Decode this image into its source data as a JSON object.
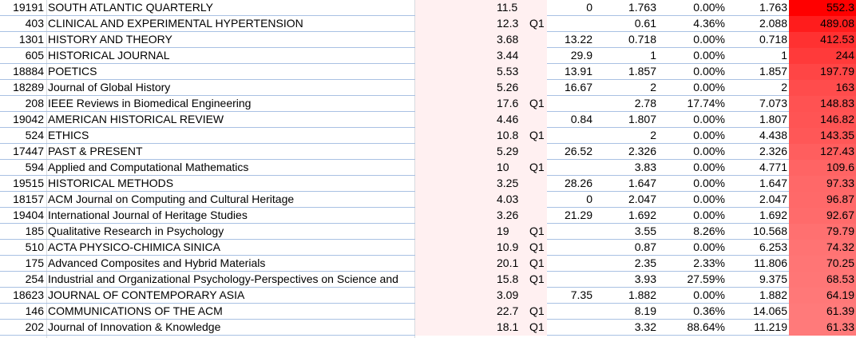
{
  "rows": [
    {
      "id": "19191",
      "name": "SOUTH ATLANTIC QUARTERLY",
      "if": "11.5",
      "q": "",
      "v2": "0",
      "v3": "1.763",
      "v4": "0.00%",
      "v5": "1.763",
      "v6": "552.3",
      "heat": "#ff0000"
    },
    {
      "id": "403",
      "name": "CLINICAL AND EXPERIMENTAL HYPERTENSION",
      "if": "12.3",
      "q": "Q1",
      "v2": "",
      "v3": "0.61",
      "v4": "4.36%",
      "v5": "2.088",
      "v6": "489.08",
      "heat": "#ff1c1c"
    },
    {
      "id": "1301",
      "name": "HISTORY AND THEORY",
      "if": "3.68",
      "q": "",
      "v2": "13.22",
      "v3": "0.718",
      "v4": "0.00%",
      "v5": "0.718",
      "v6": "412.53",
      "heat": "#ff3131"
    },
    {
      "id": "605",
      "name": "HISTORICAL JOURNAL",
      "if": "3.44",
      "q": "",
      "v2": "29.9",
      "v3": "1",
      "v4": "0.00%",
      "v5": "1",
      "v6": "244",
      "heat": "#ff3a3a"
    },
    {
      "id": "18884",
      "name": "POETICS",
      "if": "5.53",
      "q": "",
      "v2": "13.91",
      "v3": "1.857",
      "v4": "0.00%",
      "v5": "1.857",
      "v6": "197.79",
      "heat": "#ff4545"
    },
    {
      "id": "18289",
      "name": "Journal of Global History",
      "if": "5.26",
      "q": "",
      "v2": "16.67",
      "v3": "2",
      "v4": "0.00%",
      "v5": "2",
      "v6": "163",
      "heat": "#ff4c4c"
    },
    {
      "id": "208",
      "name": "IEEE Reviews in Biomedical Engineering",
      "if": "17.6",
      "q": "Q1",
      "v2": "",
      "v3": "2.78",
      "v4": "17.74%",
      "v5": "7.073",
      "v6": "148.83",
      "heat": "#ff5252"
    },
    {
      "id": "19042",
      "name": "AMERICAN HISTORICAL REVIEW",
      "if": "4.46",
      "q": "",
      "v2": "0.84",
      "v3": "1.807",
      "v4": "0.00%",
      "v5": "1.807",
      "v6": "146.82",
      "heat": "#ff5454"
    },
    {
      "id": "524",
      "name": "ETHICS",
      "if": "10.8",
      "q": "Q1",
      "v2": "",
      "v3": "2",
      "v4": "0.00%",
      "v5": "4.438",
      "v6": "143.35",
      "heat": "#ff5757"
    },
    {
      "id": "17447",
      "name": "PAST & PRESENT",
      "if": "5.29",
      "q": "",
      "v2": "26.52",
      "v3": "2.326",
      "v4": "0.00%",
      "v5": "2.326",
      "v6": "127.43",
      "heat": "#ff5e5e"
    },
    {
      "id": "594",
      "name": "Applied and Computational Mathematics",
      "if": "10",
      "q": "Q1",
      "v2": "",
      "v3": "3.83",
      "v4": "0.00%",
      "v5": "4.771",
      "v6": "109.6",
      "heat": "#ff6464"
    },
    {
      "id": "19515",
      "name": "HISTORICAL METHODS",
      "if": "3.25",
      "q": "",
      "v2": "28.26",
      "v3": "1.647",
      "v4": "0.00%",
      "v5": "1.647",
      "v6": "97.33",
      "heat": "#ff6868"
    },
    {
      "id": "18157",
      "name": "ACM Journal on Computing and Cultural Heritage",
      "if": "4.03",
      "q": "",
      "v2": "0",
      "v3": "2.047",
      "v4": "0.00%",
      "v5": "2.047",
      "v6": "96.87",
      "heat": "#ff6969"
    },
    {
      "id": "19404",
      "name": "International Journal of Heritage Studies",
      "if": "3.26",
      "q": "",
      "v2": "21.29",
      "v3": "1.692",
      "v4": "0.00%",
      "v5": "1.692",
      "v6": "92.67",
      "heat": "#ff6b6b"
    },
    {
      "id": "185",
      "name": "Qualitative Research in Psychology",
      "if": "19",
      "q": "Q1",
      "v2": "",
      "v3": "3.55",
      "v4": "8.26%",
      "v5": "10.568",
      "v6": "79.79",
      "heat": "#ff7070"
    },
    {
      "id": "510",
      "name": "ACTA PHYSICO-CHIMICA SINICA",
      "if": "10.9",
      "q": "Q1",
      "v2": "",
      "v3": "0.87",
      "v4": "0.00%",
      "v5": "6.253",
      "v6": "74.32",
      "heat": "#ff7373"
    },
    {
      "id": "175",
      "name": "Advanced Composites and Hybrid Materials",
      "if": "20.1",
      "q": "Q1",
      "v2": "",
      "v3": "2.35",
      "v4": "2.33%",
      "v5": "11.806",
      "v6": "70.25",
      "heat": "#ff7575"
    },
    {
      "id": "254",
      "name": "Industrial and Organizational Psychology-Perspectives on Science and",
      "if": "15.8",
      "q": "Q1",
      "v2": "",
      "v3": "3.93",
      "v4": "27.59%",
      "v5": "9.375",
      "v6": "68.53",
      "heat": "#ff7676"
    },
    {
      "id": "18623",
      "name": "JOURNAL OF CONTEMPORARY ASIA",
      "if": "3.09",
      "q": "",
      "v2": "7.35",
      "v3": "1.882",
      "v4": "0.00%",
      "v5": "1.882",
      "v6": "64.19",
      "heat": "#ff7878"
    },
    {
      "id": "146",
      "name": "COMMUNICATIONS OF THE ACM",
      "if": "22.7",
      "q": "Q1",
      "v2": "",
      "v3": "8.19",
      "v4": "0.36%",
      "v5": "14.065",
      "v6": "61.39",
      "heat": "#ff7a7a"
    },
    {
      "id": "202",
      "name": "Journal of Innovation & Knowledge",
      "if": "18.1",
      "q": "Q1",
      "v2": "",
      "v3": "3.32",
      "v4": "88.64%",
      "v5": "11.219",
      "v6": "61.33",
      "heat": "#ff7a7a"
    }
  ],
  "colors": {
    "grid": "#a9c1e3",
    "if_fill": "#fff0f1"
  }
}
